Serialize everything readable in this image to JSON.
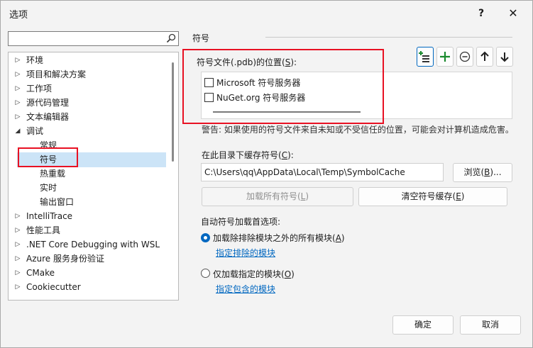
{
  "window": {
    "title": "选项",
    "help_label": "?",
    "close_label": "✕"
  },
  "search": {
    "value": "",
    "placeholder": ""
  },
  "tree": {
    "items": [
      {
        "label": "环境",
        "arrow": "▷"
      },
      {
        "label": "项目和解决方案",
        "arrow": "▷"
      },
      {
        "label": "工作项",
        "arrow": "▷"
      },
      {
        "label": "源代码管理",
        "arrow": "▷"
      },
      {
        "label": "文本编辑器",
        "arrow": "▷"
      },
      {
        "label": "调试",
        "arrow": "◢"
      },
      {
        "label": "常规",
        "arrow": ""
      },
      {
        "label": "符号",
        "arrow": ""
      },
      {
        "label": "热重载",
        "arrow": ""
      },
      {
        "label": "实时",
        "arrow": ""
      },
      {
        "label": "输出窗口",
        "arrow": ""
      },
      {
        "label": "IntelliTrace",
        "arrow": "▷"
      },
      {
        "label": "性能工具",
        "arrow": "▷"
      },
      {
        "label": ".NET Core Debugging with WSL",
        "arrow": "▷"
      },
      {
        "label": "Azure 服务身份验证",
        "arrow": "▷"
      },
      {
        "label": "CMake",
        "arrow": "▷"
      },
      {
        "label": "Cookiecutter",
        "arrow": "▷"
      }
    ],
    "selected": "符号"
  },
  "symbols": {
    "section_title": "符号",
    "locations_label_pre": "符号文件(.pdb)的位置(",
    "locations_label_key": "S",
    "locations_label_post": "):",
    "locations": [
      {
        "label": "Microsoft 符号服务器",
        "checked": false
      },
      {
        "label": "NuGet.org 符号服务器",
        "checked": false
      }
    ],
    "toolbar_icons": [
      "add-location-icon",
      "plus-icon",
      "remove-icon",
      "move-up-icon",
      "move-down-icon"
    ],
    "warning": "警告: 如果使用的符号文件来自未知或不受信任的位置，可能会对计算机造成危害。",
    "cache_label_pre": "在此目录下缓存符号(",
    "cache_label_key": "C",
    "cache_label_post": "):",
    "cache_path": "C:\\Users\\qq\\AppData\\Local\\Temp\\SymbolCache",
    "browse_pre": "浏览(",
    "browse_key": "B",
    "browse_post": ")...",
    "load_all_pre": "加载所有符号(",
    "load_all_key": "L",
    "load_all_post": ")",
    "clear_cache_pre": "清空符号缓存(",
    "clear_cache_key": "E",
    "clear_cache_post": ")",
    "auto_label": "自动符号加载首选项:",
    "option_all_pre": "加载除排除模块之外的所有模块(",
    "option_all_key": "A",
    "option_all_post": ")",
    "exclude_link": "指定排除的模块",
    "option_specified_pre": "仅加载指定的模块(",
    "option_specified_key": "O",
    "option_specified_post": ")",
    "include_link": "指定包含的模块",
    "selected_option": "all"
  },
  "footer": {
    "ok_label": "确定",
    "cancel_label": "取消"
  },
  "colors": {
    "accent": "#0067c0",
    "highlight": "#e81123",
    "selection": "#cce4f7"
  }
}
